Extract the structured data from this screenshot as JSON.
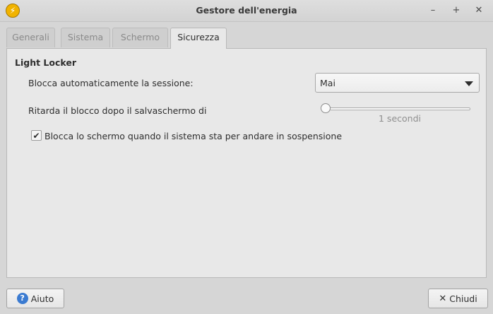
{
  "window": {
    "title": "Gestore dell'energia",
    "icon": "lightning-icon",
    "controls": {
      "minimize": "–",
      "maximize": "+",
      "close": "✕"
    }
  },
  "tabs": [
    {
      "label": "Generali",
      "active": false
    },
    {
      "label": "Sistema",
      "active": false
    },
    {
      "label": "Schermo",
      "active": false
    },
    {
      "label": "Sicurezza",
      "active": true
    }
  ],
  "section": {
    "title": "Light Locker",
    "auto_lock_label": "Blocca automaticamente la sessione:",
    "auto_lock_value": "Mai",
    "delay_label": "Ritarda il blocco dopo il salvaschermo di",
    "delay_value": "1 secondi",
    "delay_fraction": 0.0,
    "suspend_lock_label": "Blocca lo schermo quando il sistema sta per andare in sospensione",
    "suspend_lock_checked": true
  },
  "footer": {
    "help_label": "Aiuto",
    "close_label": "Chiudi"
  },
  "colors": {
    "help_icon": "#3b7bd1",
    "app_icon": "#f1b300"
  }
}
